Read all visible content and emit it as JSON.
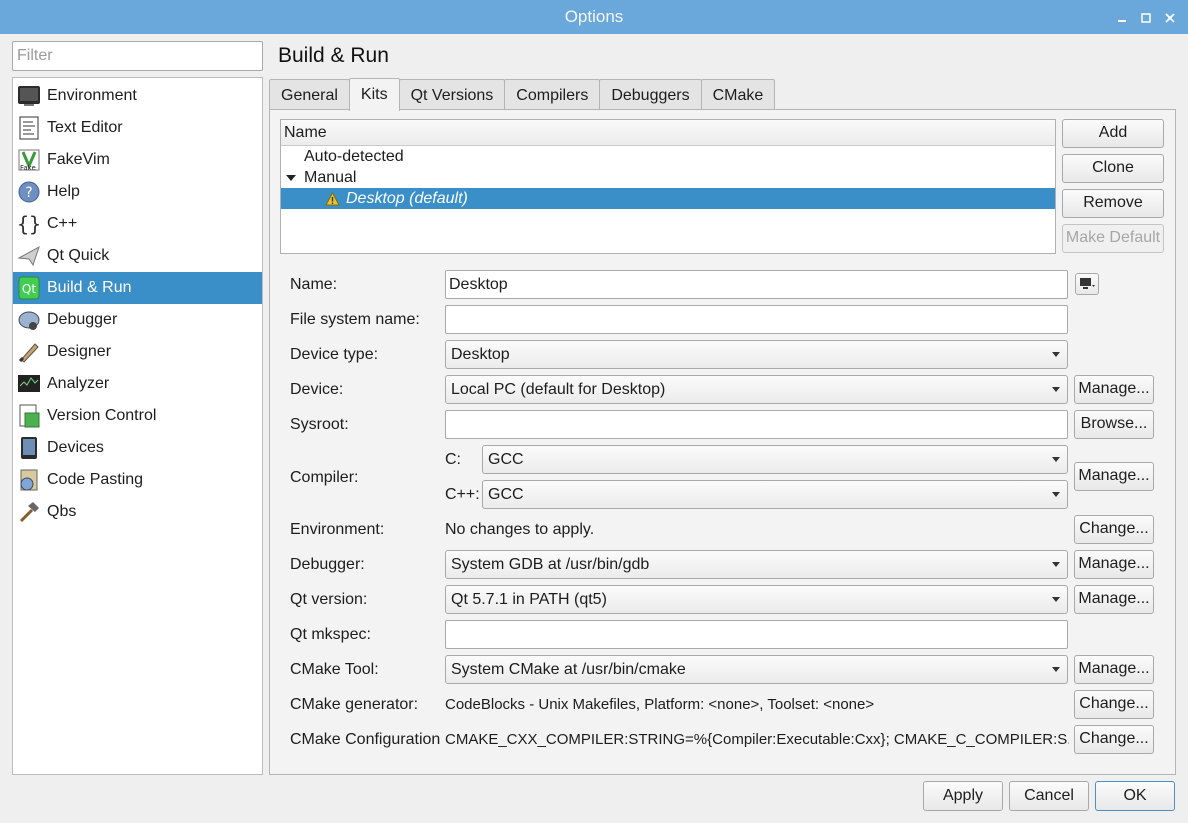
{
  "window": {
    "title": "Options"
  },
  "sidebar": {
    "filter_placeholder": "Filter",
    "items": [
      {
        "label": "Environment",
        "icon": "monitor-icon"
      },
      {
        "label": "Text Editor",
        "icon": "text-document-icon"
      },
      {
        "label": "FakeVim",
        "icon": "fakevim-icon"
      },
      {
        "label": "Help",
        "icon": "help-icon"
      },
      {
        "label": "C++",
        "icon": "braces-icon"
      },
      {
        "label": "Qt Quick",
        "icon": "paper-plane-icon"
      },
      {
        "label": "Build & Run",
        "icon": "qt-build-icon",
        "selected": true
      },
      {
        "label": "Debugger",
        "icon": "debugger-icon"
      },
      {
        "label": "Designer",
        "icon": "designer-brush-icon"
      },
      {
        "label": "Analyzer",
        "icon": "analyzer-icon"
      },
      {
        "label": "Version Control",
        "icon": "version-control-icon"
      },
      {
        "label": "Devices",
        "icon": "device-icon"
      },
      {
        "label": "Code Pasting",
        "icon": "code-pasting-icon"
      },
      {
        "label": "Qbs",
        "icon": "hammer-icon"
      }
    ]
  },
  "page": {
    "title": "Build & Run",
    "tabs": [
      "General",
      "Kits",
      "Qt Versions",
      "Compilers",
      "Debuggers",
      "CMake"
    ],
    "active_tab": "Kits"
  },
  "kits_tree": {
    "header": "Name",
    "rows": [
      {
        "label": "Auto-detected"
      },
      {
        "label": "Manual",
        "expanded": true
      },
      {
        "label": "Desktop (default)",
        "selected": true,
        "warning": true
      }
    ]
  },
  "kit_buttons": {
    "add": "Add",
    "clone": "Clone",
    "remove": "Remove",
    "make_default": "Make Default"
  },
  "form": {
    "name": {
      "label": "Name:",
      "value": "Desktop"
    },
    "fs_name": {
      "label": "File system name:",
      "value": ""
    },
    "device_type": {
      "label": "Device type:",
      "value": "Desktop"
    },
    "device": {
      "label": "Device:",
      "value": "Local PC (default for Desktop)",
      "button": "Manage..."
    },
    "sysroot": {
      "label": "Sysroot:",
      "value": "",
      "button": "Browse..."
    },
    "compiler": {
      "label": "Compiler:",
      "c_label": "C:",
      "c_value": "GCC",
      "cxx_label": "C++:",
      "cxx_value": "GCC",
      "button": "Manage..."
    },
    "environment": {
      "label": "Environment:",
      "value": "No changes to apply.",
      "button": "Change..."
    },
    "debugger": {
      "label": "Debugger:",
      "value": "System GDB at /usr/bin/gdb",
      "button": "Manage..."
    },
    "qt_version": {
      "label": "Qt version:",
      "value": "Qt 5.7.1 in PATH (qt5)",
      "button": "Manage..."
    },
    "qt_mkspec": {
      "label": "Qt mkspec:",
      "value": ""
    },
    "cmake_tool": {
      "label": "CMake Tool:",
      "value": "System CMake at /usr/bin/cmake",
      "button": "Manage..."
    },
    "cmake_generator": {
      "label": "CMake generator:",
      "value": "CodeBlocks - Unix Makefiles, Platform: <none>, Toolset: <none>",
      "button": "Change..."
    },
    "cmake_config": {
      "label": "CMake Configuration",
      "value": "CMAKE_CXX_COMPILER:STRING=%{Compiler:Executable:Cxx}; CMAKE_C_COMPILER:S...",
      "button": "Change..."
    }
  },
  "footer": {
    "apply": "Apply",
    "cancel": "Cancel",
    "ok": "OK"
  },
  "colors": {
    "titlebar": "#6aa7db",
    "selection": "#3a8fc9"
  }
}
